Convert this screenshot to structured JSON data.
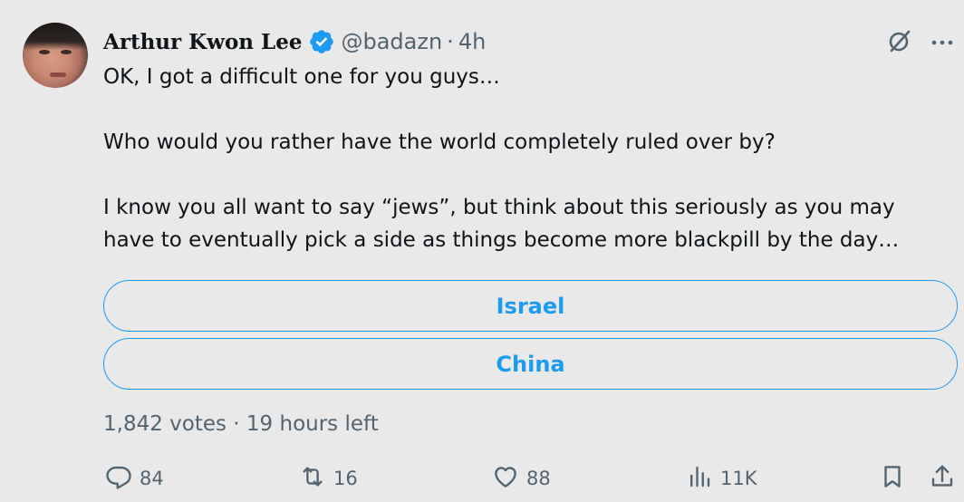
{
  "author": {
    "name": "Arthur Kwon Lee",
    "handle": "@badazn",
    "separator": "·",
    "time": "4h",
    "verified": true
  },
  "tweet": {
    "lines": [
      "OK, I got a difficult one for you guys…",
      "",
      "Who would you rather have the world completely ruled over by?",
      "",
      "I know you all want to say “jews”, but think about this seriously as you may",
      "have to eventually pick a side as things become more blackpill by the day…"
    ]
  },
  "poll": {
    "options": [
      "Israel",
      "China"
    ],
    "meta": "1,842 votes · 19 hours left"
  },
  "actions": {
    "replies": "84",
    "retweets": "16",
    "likes": "88",
    "views": "11K"
  },
  "colors": {
    "background": "#e9e9e9",
    "accent": "#1d9bf0",
    "muted": "#536471",
    "text": "#0f1419"
  },
  "icons": [
    "verified-badge-icon",
    "grok-icon",
    "more-icon",
    "reply-icon",
    "retweet-icon",
    "like-icon",
    "views-icon",
    "bookmark-icon",
    "share-icon"
  ]
}
